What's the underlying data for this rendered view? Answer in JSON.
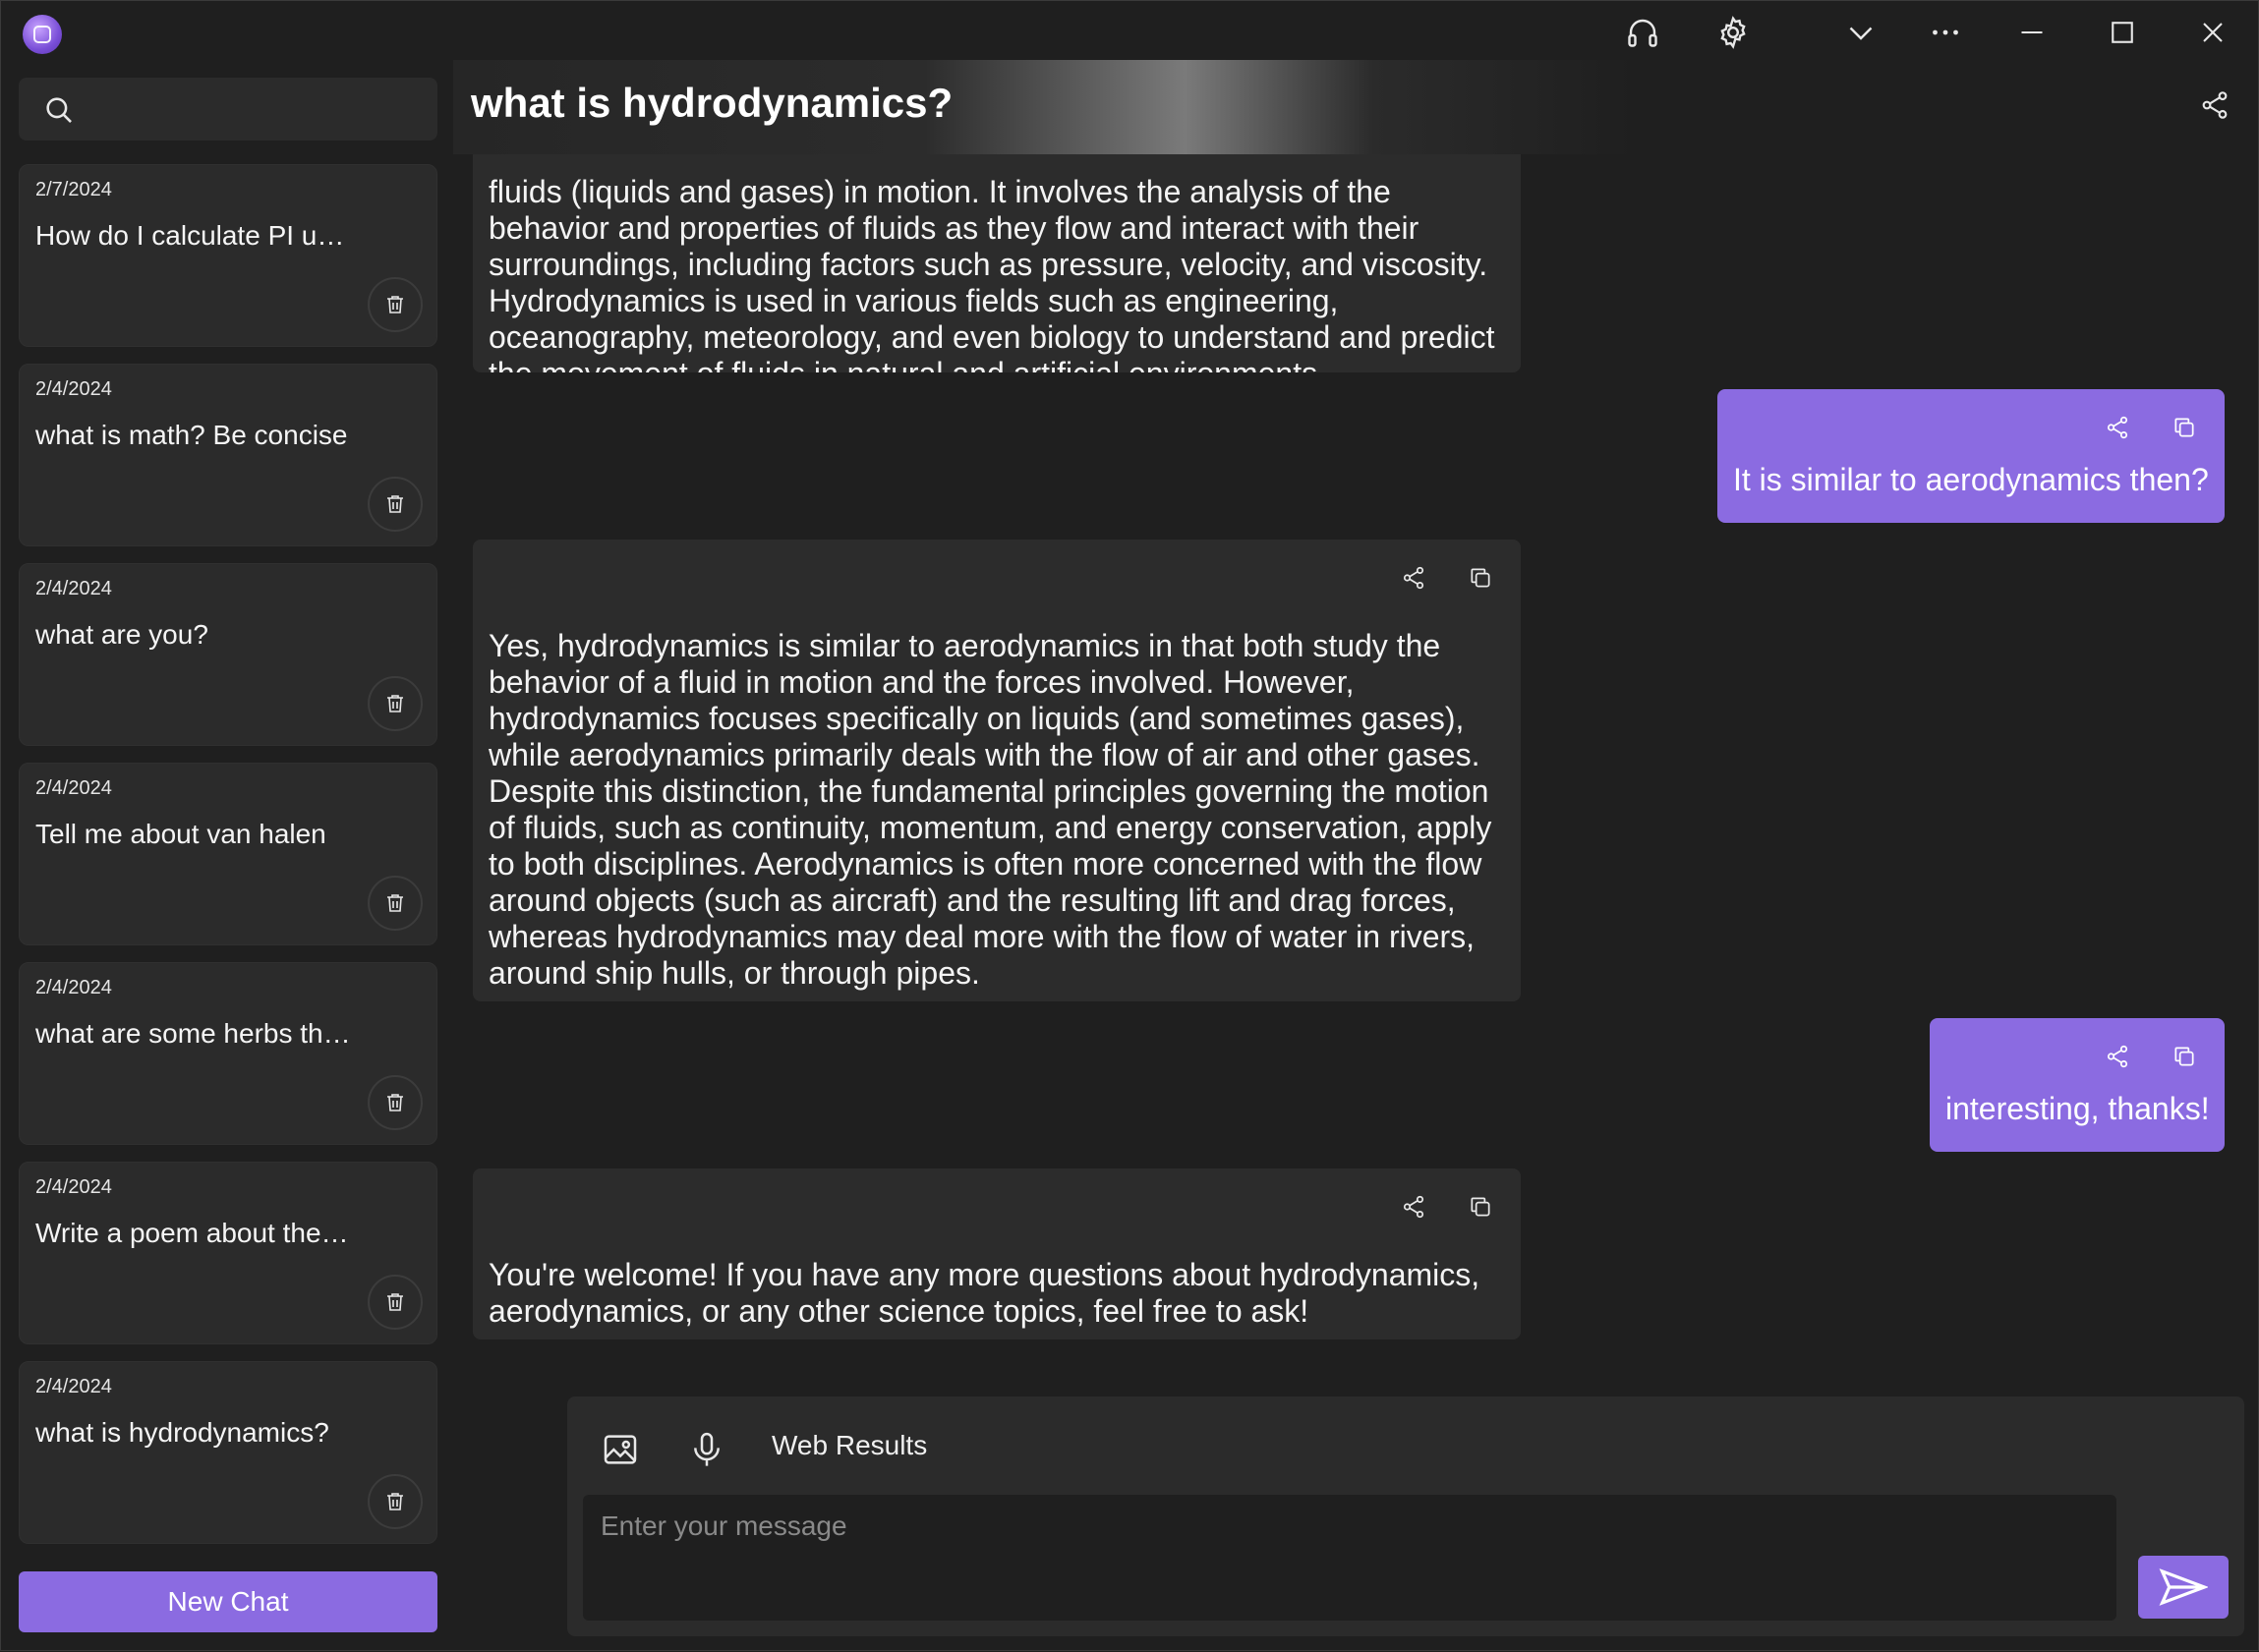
{
  "app": {
    "name": "AI chat app"
  },
  "titlebar": {
    "icons": [
      "headphones-icon",
      "gear-icon",
      "chevron-down-icon",
      "more-icon",
      "minimize-icon",
      "maximize-icon",
      "close-icon"
    ]
  },
  "sidebar": {
    "search_placeholder": "",
    "chats": [
      {
        "date": "2/7/2024",
        "title": "How do I calculate PI u…"
      },
      {
        "date": "2/4/2024",
        "title": "what is math? Be concise"
      },
      {
        "date": "2/4/2024",
        "title": "what are you?"
      },
      {
        "date": "2/4/2024",
        "title": "Tell me about van halen"
      },
      {
        "date": "2/4/2024",
        "title": "what are some herbs th…"
      },
      {
        "date": "2/4/2024",
        "title": "Write a poem about the…"
      },
      {
        "date": "2/4/2024",
        "title": "what is hydrodynamics?"
      }
    ],
    "new_chat_label": "New Chat"
  },
  "main": {
    "title": "what is hydrodynamics?",
    "messages": [
      {
        "role": "assistant",
        "text": "fluids (liquids and gases) in motion. It involves the analysis of the behavior and properties of fluids as they flow and interact with their surroundings, including factors such as pressure, velocity, and viscosity. Hydrodynamics is used in various fields such as engineering, oceanography, meteorology, and even biology to understand and predict the movement of fluids in natural and artificial environments."
      },
      {
        "role": "user",
        "text": "It is similar to aerodynamics then?"
      },
      {
        "role": "assistant",
        "text": "Yes, hydrodynamics is similar to aerodynamics in that both study the behavior of a fluid in motion and the forces involved. However, hydrodynamics focuses specifically on liquids (and sometimes gases), while aerodynamics primarily deals with the flow of air and other gases. Despite this distinction, the fundamental principles governing the motion of fluids, such as continuity, momentum, and energy conservation, apply to both disciplines. Aerodynamics is often more concerned with the flow around objects (such as aircraft) and the resulting lift and drag forces, whereas hydrodynamics may deal more with the flow of water in rivers, around ship hulls, or through pipes."
      },
      {
        "role": "user",
        "text": "interesting, thanks!"
      },
      {
        "role": "assistant",
        "text": "You're welcome! If you have any more questions about hydrodynamics, aerodynamics, or any other science topics, feel free to ask!"
      }
    ]
  },
  "composer": {
    "web_results_label": "Web Results",
    "placeholder": "Enter your message",
    "value": ""
  },
  "colors": {
    "accent": "#8b6be1",
    "background": "#1f1f1f",
    "card": "#2b2b2b"
  }
}
